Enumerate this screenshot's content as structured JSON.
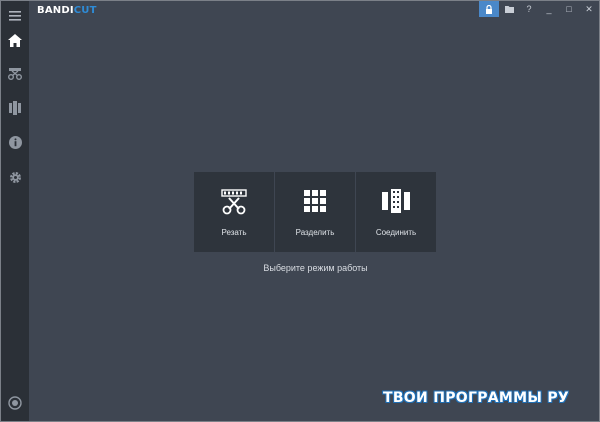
{
  "app": {
    "logo_main": "BANDI",
    "logo_accent": "CUT"
  },
  "titlebar": {
    "buttons": [
      {
        "name": "lock-icon",
        "glyph": "🔒"
      },
      {
        "name": "folder-icon",
        "glyph": "▬"
      },
      {
        "name": "help-button",
        "glyph": "?"
      },
      {
        "name": "minimize-button",
        "glyph": "_"
      },
      {
        "name": "maximize-button",
        "glyph": "□"
      },
      {
        "name": "close-button",
        "glyph": "✕"
      }
    ]
  },
  "sidebar": {
    "items": [
      "menu-icon",
      "home-icon",
      "cut-icon",
      "join-icon",
      "info-icon",
      "settings-icon",
      "record-icon"
    ]
  },
  "modes": {
    "cut": {
      "label": "Резать"
    },
    "split": {
      "label": "Разделить"
    },
    "join": {
      "label": "Соединить"
    }
  },
  "hint": "Выберите режим работы",
  "watermark": "ТВОИ ПРОГРАММЫ РУ",
  "colors": {
    "accent": "#2e8bd6",
    "sidebar": "#2b3037",
    "background": "#3f4652",
    "tile": "#2e343c"
  }
}
